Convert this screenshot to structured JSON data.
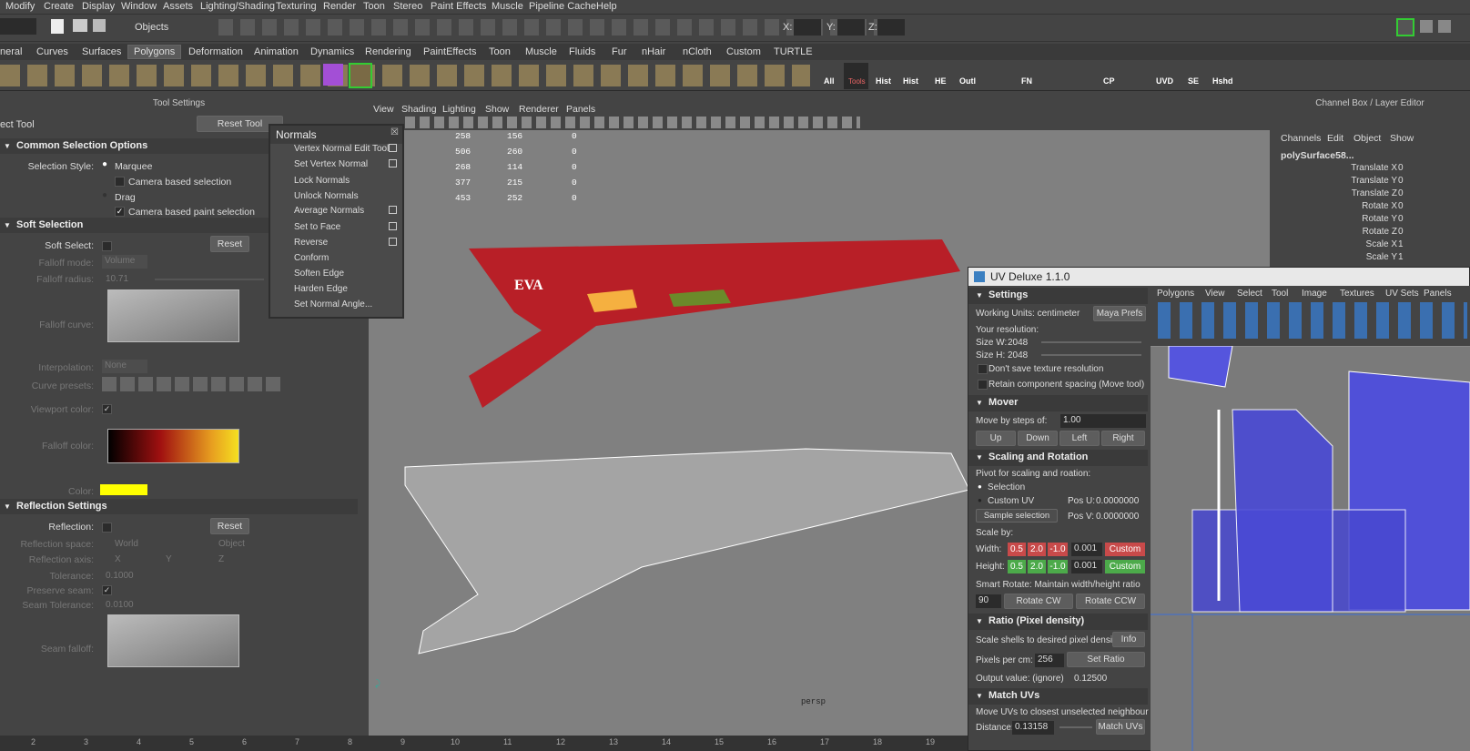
{
  "menubar": {
    "items": [
      "Modify",
      "Create",
      "Display",
      "Window",
      "Assets",
      "Lighting/Shading",
      "Texturing",
      "Render",
      "Toon",
      "Stereo",
      "Paint Effects",
      "Muscle",
      "Pipeline Cache",
      "Help"
    ]
  },
  "toolbar": {
    "objects_label": "Objects",
    "x_label": "X:",
    "y_label": "Y:",
    "z_label": "Z:"
  },
  "shelf_tabs": [
    "neral",
    "Curves",
    "Surfaces",
    "Polygons",
    "Deformation",
    "Animation",
    "Dynamics",
    "Rendering",
    "PaintEffects",
    "Toon",
    "Muscle",
    "Fluids",
    "Fur",
    "nHair",
    "nCloth",
    "Custom",
    "TURTLE"
  ],
  "shelf_labels": [
    "All",
    "Tools",
    "Hist",
    "Hist",
    "HE",
    "Outl",
    "FN",
    "CP",
    "UVD",
    "SE",
    "Hshd"
  ],
  "tool_settings": {
    "header": "Tool Settings",
    "tool_name": "ect Tool",
    "reset_tool": "Reset Tool",
    "common": "Common Selection Options",
    "selection_style": "Selection Style:",
    "marquee": "Marquee",
    "camera_based": "Camera based selection",
    "drag": "Drag",
    "camera_paint": "Camera based paint selection",
    "soft": "Soft Selection",
    "soft_select": "Soft Select:",
    "reset": "Reset",
    "falloff_mode": "Falloff mode:",
    "volume": "Volume",
    "falloff_radius": "Falloff radius:",
    "radius_val": "10.71",
    "falloff_curve": "Falloff curve:",
    "interpolation": "Interpolation:",
    "none": "None",
    "curve_presets": "Curve presets:",
    "viewport_color": "Viewport color:",
    "falloff_color": "Falloff color:",
    "color": "Color:",
    "reflection": "Reflection Settings",
    "reflection_lbl": "Reflection:",
    "refl_space": "Reflection space:",
    "world": "World",
    "object": "Object",
    "refl_axis": "Reflection axis:",
    "x": "X",
    "y": "Y",
    "z": "Z",
    "tolerance": "Tolerance:",
    "tol_val": "0.1000",
    "preserve": "Preserve seam:",
    "seam_tol": "Seam Tolerance:",
    "seam_val": "0.0100",
    "seam_falloff": "Seam falloff:"
  },
  "viewport": {
    "menu": [
      "View",
      "Shading",
      "Lighting",
      "Show",
      "Renderer",
      "Panels"
    ],
    "stats": [
      [
        "258",
        "156",
        "0"
      ],
      [
        "506",
        "260",
        "0"
      ],
      [
        "268",
        "114",
        "0"
      ],
      [
        "377",
        "215",
        "0"
      ],
      [
        "453",
        "252",
        "0"
      ]
    ],
    "camera": "persp",
    "text_on_model": "EVA"
  },
  "normals": {
    "title": "Normals",
    "items": [
      "Vertex Normal Edit Tool",
      "Set Vertex Normal",
      "Lock Normals",
      "Unlock Normals",
      "Average Normals",
      "Set to Face",
      "Reverse",
      "Conform",
      "Soften Edge",
      "Harden Edge",
      "Set Normal Angle..."
    ]
  },
  "channel_box": {
    "header": "Channel Box / Layer Editor",
    "menu": [
      "Channels",
      "Edit",
      "Object",
      "Show"
    ],
    "object": "polySurface58...",
    "attrs": [
      [
        "Translate X",
        "0"
      ],
      [
        "Translate Y",
        "0"
      ],
      [
        "Translate Z",
        "0"
      ],
      [
        "Rotate X",
        "0"
      ],
      [
        "Rotate Y",
        "0"
      ],
      [
        "Rotate Z",
        "0"
      ],
      [
        "Scale X",
        "1"
      ],
      [
        "Scale Y",
        "1"
      ]
    ]
  },
  "uv_deluxe": {
    "title": "UV Deluxe 1.1.0",
    "settings": "Settings",
    "working_units": "Working Units: centimeter",
    "maya_prefs": "Maya Prefs",
    "your_res": "Your resolution:",
    "size_w": "Size W:",
    "size_w_val": "2048",
    "size_h": "Size H:",
    "size_h_val": "2048",
    "dont_save": "Don't save texture resolution",
    "retain": "Retain component spacing (Move tool)",
    "mover": "Mover",
    "move_by": "Move by steps of:",
    "move_val": "1.00",
    "up": "Up",
    "down": "Down",
    "left": "Left",
    "right": "Right",
    "scaling": "Scaling and Rotation",
    "pivot": "Pivot for scaling and roation:",
    "selection": "Selection",
    "custom_uv": "Custom UV",
    "pos_u": "Pos U:",
    "pos_v": "Pos V:",
    "pos_val": "0.0000000",
    "sample": "Sample selection",
    "scale_by": "Scale by:",
    "width": "Width:",
    "height": "Height:",
    "s05": "0.5",
    "s20": "2.0",
    "sm10": "-1.0",
    "s0001": "0.001",
    "custom": "Custom",
    "smart_rotate": "Smart Rotate: Maintain width/height ratio",
    "deg": "90",
    "rot_cw": "Rotate CW",
    "rot_ccw": "Rotate CCW",
    "ratio": "Ratio (Pixel density)",
    "scale_shells": "Scale shells to desired pixel density",
    "info": "Info",
    "ppcm": "Pixels per cm:",
    "ppcm_val": "256",
    "set_ratio": "Set Ratio",
    "output": "Output value: (ignore)",
    "output_val": "0.12500",
    "match": "Match UVs",
    "move_closest": "Move UVs to closest unselected neighbour",
    "distance": "Distance:",
    "dist_val": "0.13158",
    "match_btn": "Match UVs"
  },
  "uv_editor": {
    "menu": [
      "Polygons",
      "View",
      "Select",
      "Tool",
      "Image",
      "Textures",
      "UV Sets",
      "Panels"
    ]
  },
  "ruler": [
    "2",
    "3",
    "4",
    "5",
    "6",
    "7",
    "8",
    "9",
    "10",
    "11",
    "12",
    "13",
    "14",
    "15",
    "16",
    "17",
    "18",
    "19"
  ]
}
